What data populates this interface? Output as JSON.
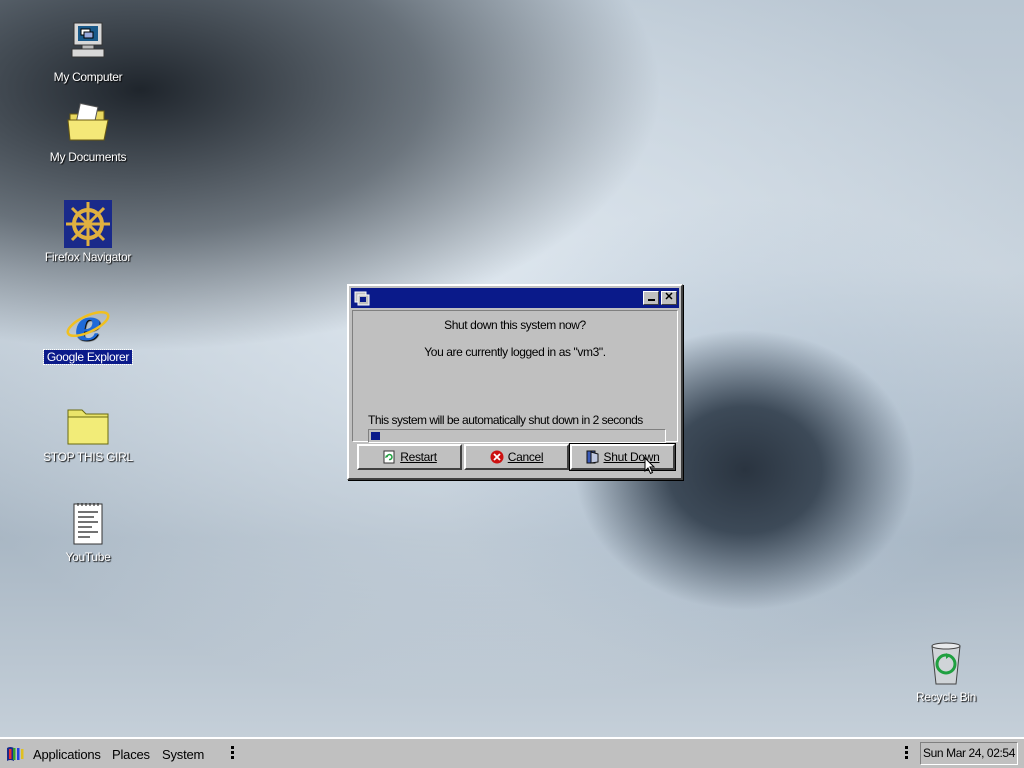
{
  "desktop": {
    "icons": [
      {
        "label": "My Computer"
      },
      {
        "label": "My Documents"
      },
      {
        "label": "Firefox Navigator"
      },
      {
        "label": "Google Explorer"
      },
      {
        "label": "STOP THIS GIRL"
      },
      {
        "label": "YouTube"
      },
      {
        "label": "Recycle Bin"
      }
    ]
  },
  "dialog": {
    "title": "",
    "question": "Shut down this system now?",
    "logged_in": "You are currently logged in as \"vm3\".",
    "countdown": "This system will be automatically shut down in 2 seconds",
    "progress": 0.03,
    "buttons": {
      "restart": "Restart",
      "cancel": "Cancel",
      "shutdown": "Shut Down"
    }
  },
  "taskbar": {
    "applications": "Applications",
    "places": "Places",
    "system": "System",
    "clock": "Sun Mar 24, 02:54"
  },
  "colors": {
    "titlebar": "#0a1a8a",
    "face": "#c0c0c0",
    "cancel_icon": "#cc1111"
  }
}
